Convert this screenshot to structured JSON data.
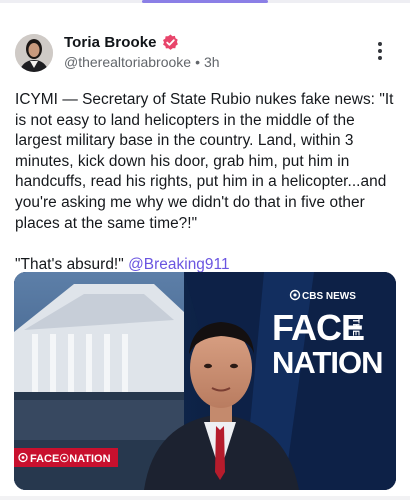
{
  "post": {
    "author": {
      "display_name": "Toria Brooke",
      "handle": "@therealtoriabrooke",
      "time": "3h",
      "separator": "•"
    },
    "text": "ICYMI — Secretary of State Rubio nukes fake news: \"It is not easy to land helicopters in the middle of the largest military base in the country. Land, within 3 minutes, kick down his door, grab him, put him in handcuffs, read his rights, put him in a helicopter...and you're asking me why we didn't do that in five other places at the same time?!\"\n\n\"That's absurd!\" ",
    "mention": "@Breaking911",
    "media": {
      "logo_brand": "CBS NEWS",
      "show_face": "FACE",
      "show_the": "THE",
      "show_nation": "NATION",
      "banner": "FACE☉NATION"
    }
  },
  "colors": {
    "accent": "#8b7fe6",
    "mention": "#6a55e0",
    "verified": "#e8456b"
  },
  "icons": [
    "verified-badge-icon",
    "more-options-icon"
  ]
}
